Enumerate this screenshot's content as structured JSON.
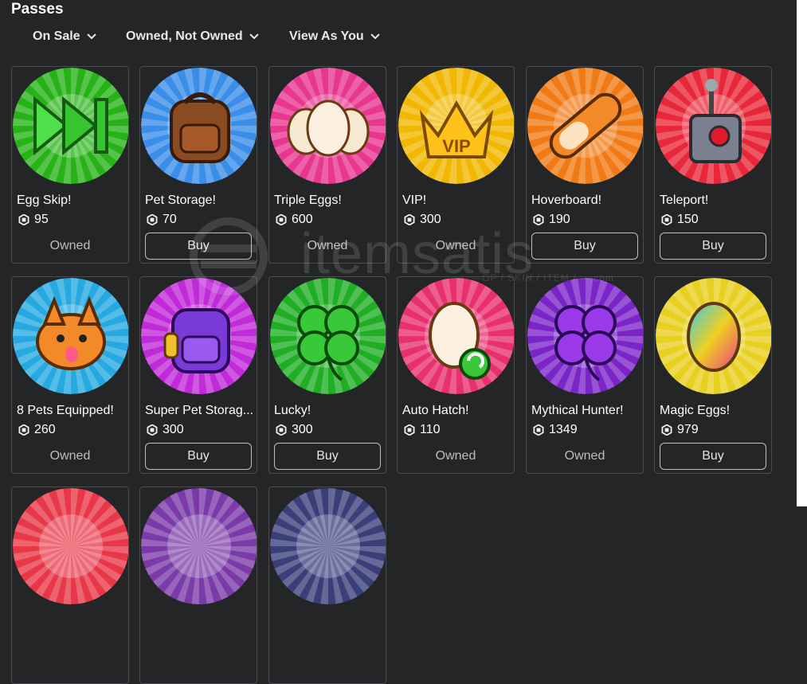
{
  "header": {
    "title": "Passes"
  },
  "filters": [
    {
      "label": "On Sale"
    },
    {
      "label": "Owned, Not Owned"
    },
    {
      "label": "View As You"
    }
  ],
  "watermark": {
    "text": "itemsatis",
    "sub": "—OP / SKIN / ITEM / —.com"
  },
  "cards": [
    {
      "name": "Egg Skip!",
      "price": "95",
      "status": "owned",
      "status_label": "Owned",
      "icon": "fast-forward-icon",
      "bg": "#27b318"
    },
    {
      "name": "Pet Storage!",
      "price": "70",
      "status": "buy",
      "status_label": "Buy",
      "icon": "backpack-icon",
      "bg": "#3a8de8"
    },
    {
      "name": "Triple Eggs!",
      "price": "600",
      "status": "owned",
      "status_label": "Owned",
      "icon": "triple-eggs-icon",
      "bg": "#e8378f"
    },
    {
      "name": "VIP!",
      "price": "300",
      "status": "owned",
      "status_label": "Owned",
      "icon": "vip-crown-icon",
      "bg": "#f0b800"
    },
    {
      "name": "Hoverboard!",
      "price": "190",
      "status": "buy",
      "status_label": "Buy",
      "icon": "hoverboard-icon",
      "bg": "#f07a16"
    },
    {
      "name": "Teleport!",
      "price": "150",
      "status": "buy",
      "status_label": "Buy",
      "icon": "teleport-remote-icon",
      "bg": "#e8283a"
    },
    {
      "name": "8 Pets Equipped!",
      "price": "260",
      "status": "owned",
      "status_label": "Owned",
      "icon": "dog-pet-icon",
      "bg": "#25a9e0"
    },
    {
      "name": "Super Pet Storag...",
      "price": "300",
      "status": "buy",
      "status_label": "Buy",
      "icon": "purple-backpack-icon",
      "bg": "#c02ad8"
    },
    {
      "name": "Lucky!",
      "price": "300",
      "status": "buy",
      "status_label": "Buy",
      "icon": "clover-icon",
      "bg": "#1fae24"
    },
    {
      "name": "Auto Hatch!",
      "price": "110",
      "status": "owned",
      "status_label": "Owned",
      "icon": "auto-hatch-egg-icon",
      "bg": "#e8306e"
    },
    {
      "name": "Mythical Hunter!",
      "price": "1349",
      "status": "owned",
      "status_label": "Owned",
      "icon": "mythical-clover-icon",
      "bg": "#7b24c8"
    },
    {
      "name": "Magic Eggs!",
      "price": "979",
      "status": "buy",
      "status_label": "Buy",
      "icon": "magic-egg-icon",
      "bg": "#e8d020"
    }
  ],
  "partial_cards": [
    {
      "icon": "partial-pass-icon",
      "bg": "#e83848"
    },
    {
      "icon": "partial-pass-icon",
      "bg": "#7a3aa8"
    },
    {
      "icon": "partial-pass-icon",
      "bg": "#3a3f7a"
    }
  ]
}
